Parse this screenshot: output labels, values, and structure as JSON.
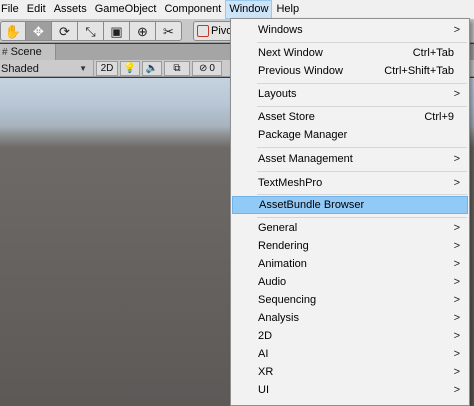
{
  "menubar": {
    "items": [
      "File",
      "Edit",
      "Assets",
      "GameObject",
      "Component",
      "Window",
      "Help"
    ],
    "active": "Window"
  },
  "toolbar": {
    "tools": [
      {
        "icon": "hand-icon",
        "glyph": "✋"
      },
      {
        "icon": "move-icon",
        "glyph": "✥"
      },
      {
        "icon": "rotate-icon",
        "glyph": "⟳"
      },
      {
        "icon": "scale-icon",
        "glyph": "⤡"
      },
      {
        "icon": "rect-icon",
        "glyph": "▣"
      },
      {
        "icon": "transform-icon",
        "glyph": "⊕"
      },
      {
        "icon": "custom-tool-icon",
        "glyph": "✂"
      }
    ],
    "pivot_label": "Pivo"
  },
  "scene_tab": {
    "label": "Scene"
  },
  "scene_bar": {
    "shading_mode": "Shaded",
    "mode_2d": "2D",
    "controls": [
      {
        "icon": "lighting-icon",
        "glyph": "💡"
      },
      {
        "icon": "audio-icon",
        "glyph": "🔈"
      },
      {
        "icon": "effects-icon",
        "glyph": "⧉"
      },
      {
        "icon": "visibility-icon",
        "glyph": "⊘"
      }
    ],
    "visibility_count": "0"
  },
  "window_menu": {
    "items": [
      {
        "label": "Windows",
        "shortcut": "",
        "submenu": true
      },
      {
        "label": "Next Window",
        "shortcut": "Ctrl+Tab",
        "submenu": false
      },
      {
        "label": "Previous Window",
        "shortcut": "Ctrl+Shift+Tab",
        "submenu": false
      },
      {
        "label": "Layouts",
        "shortcut": "",
        "submenu": true
      },
      {
        "label": "Asset Store",
        "shortcut": "Ctrl+9",
        "submenu": false
      },
      {
        "label": "Package Manager",
        "shortcut": "",
        "submenu": false
      },
      {
        "label": "Asset Management",
        "shortcut": "",
        "submenu": true
      },
      {
        "label": "TextMeshPro",
        "shortcut": "",
        "submenu": true
      },
      {
        "label": "AssetBundle Browser",
        "shortcut": "",
        "submenu": false
      },
      {
        "label": "General",
        "shortcut": "",
        "submenu": true
      },
      {
        "label": "Rendering",
        "shortcut": "",
        "submenu": true
      },
      {
        "label": "Animation",
        "shortcut": "",
        "submenu": true
      },
      {
        "label": "Audio",
        "shortcut": "",
        "submenu": true
      },
      {
        "label": "Sequencing",
        "shortcut": "",
        "submenu": true
      },
      {
        "label": "Analysis",
        "shortcut": "",
        "submenu": true
      },
      {
        "label": "2D",
        "shortcut": "",
        "submenu": true
      },
      {
        "label": "AI",
        "shortcut": "",
        "submenu": true
      },
      {
        "label": "XR",
        "shortcut": "",
        "submenu": true
      },
      {
        "label": "UI",
        "shortcut": "",
        "submenu": true
      }
    ],
    "highlighted": "AssetBundle Browser",
    "submenu_arrow": ">"
  },
  "colors": {
    "highlight": "#91c9f7",
    "menubar_active": "#cce4f7",
    "menu_bg": "#f2f2f2"
  }
}
